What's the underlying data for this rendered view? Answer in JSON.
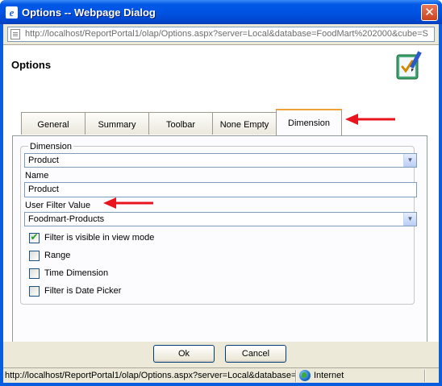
{
  "window": {
    "title": "Options -- Webpage Dialog",
    "close_glyph": "✕",
    "title_icon": "ie-icon"
  },
  "address": {
    "url": "http://localhost/ReportPortal1/olap/Options.aspx?server=Local&database=FoodMart%202000&cube=S"
  },
  "header": {
    "title": "Options",
    "icon": "checklist-pencil-icon"
  },
  "tabs": [
    {
      "label": "General"
    },
    {
      "label": "Summary"
    },
    {
      "label": "Toolbar"
    },
    {
      "label": "None Empty"
    },
    {
      "label": "Dimension",
      "active": true
    }
  ],
  "dimension_group": {
    "legend": "Dimension",
    "dimension_value": "Product",
    "name_label": "Name",
    "name_value": "Product",
    "filter_label": "User Filter Value",
    "filter_value": "Foodmart-Products",
    "checkboxes": [
      {
        "label": "Filter is visible in view mode",
        "checked": true
      },
      {
        "label": "Range",
        "checked": false
      },
      {
        "label": "Time Dimension",
        "checked": false
      },
      {
        "label": "Filter is Date Picker",
        "checked": false
      }
    ]
  },
  "buttons": {
    "ok": "Ok",
    "cancel": "Cancel"
  },
  "status": {
    "text": "http://localhost/ReportPortal1/olap/Options.aspx?server=Local&database=",
    "zone": "Internet"
  },
  "colors": {
    "titlebar": "#0054e3",
    "tab_active_accent": "#f2a13a",
    "annotation_arrow": "#e8141e",
    "check_tick": "#21a121"
  }
}
